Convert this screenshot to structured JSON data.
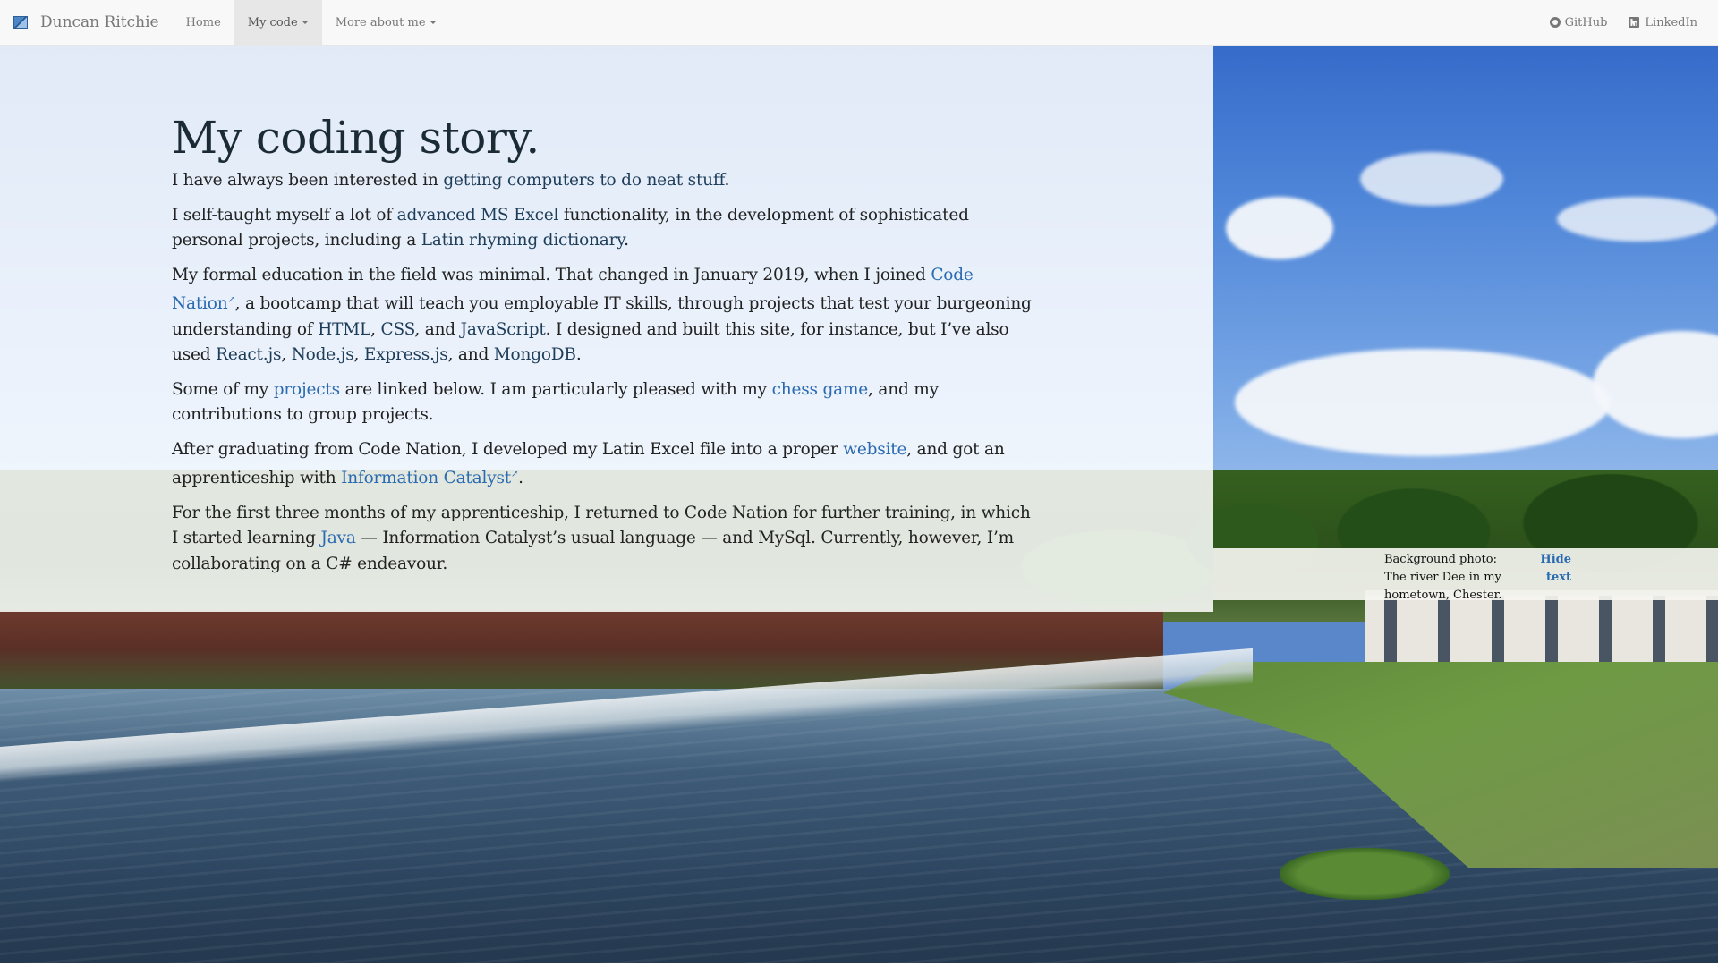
{
  "navbar": {
    "brand_name": "Duncan Ritchie",
    "brand_icon": "site-logo-icon",
    "links": {
      "home": "Home",
      "my_code": "My code",
      "more_about": "More about me"
    },
    "right": {
      "github": "GitHub",
      "github_icon": "github-icon",
      "linkedin": "LinkedIn",
      "linkedin_icon": "linkedin-icon"
    },
    "active_item": "My code"
  },
  "story": {
    "title": "My coding story.",
    "p1": {
      "before": "I have always been interested in ",
      "tech": "getting computers to do neat stuff",
      "after": "."
    },
    "p2": {
      "before": "I self-taught myself a lot of ",
      "tech1": "advanced MS Excel",
      "mid": " functionality, in the development of sophisticated personal projects, including a ",
      "tech2": "Latin rhyming dictionary",
      "after": "."
    },
    "p3": {
      "before": "My formal education in the field was minimal. That changed in January 2019, when I joined ",
      "link": "Code Nation",
      "ext": "↗",
      "mid1": ", a bootcamp that will teach you employable IT skills, through projects that test your burgeoning understanding of ",
      "html": "HTML",
      "sep1": ", ",
      "css": "CSS",
      "sep2": ", and ",
      "js": "JavaScript",
      "mid2": ". I designed and built this site, for instance, but I’ve also used ",
      "react": "React.js",
      "sep3": ", ",
      "node": "Node.js",
      "sep4": ", ",
      "express": "Express.js",
      "sep5": ", and ",
      "mongo": "MongoDB",
      "after": "."
    },
    "p4": {
      "before": "Some of my ",
      "link1": "projects",
      "mid": " are linked below. I am particularly pleased with my ",
      "link2": "chess game",
      "after": ", and my contributions to group projects."
    },
    "p5": {
      "before": "After graduating from Code Nation, I developed my Latin Excel file into a proper ",
      "link1": "website",
      "mid": ", and got an apprenticeship with ",
      "link2": "Information Catalyst",
      "ext": "↗",
      "after": "."
    },
    "p6": {
      "before": "For the first three months of my apprenticeship, I returned to Code Nation for further training, in which I started learning ",
      "link": "Java",
      "after": " — Information Catalyst’s usual language — and MySql. Currently, however, I’m collaborating on a C# endeavour."
    }
  },
  "caption": {
    "text": "Background photo: The river Dee in my hometown, Chester.",
    "hide_label": "Hide text"
  },
  "colors": {
    "link": "#2a6ab1",
    "tech": "#1e3d59",
    "navbar_bg": "#f8f8f8",
    "active_nav_bg": "#e7e7e7"
  }
}
